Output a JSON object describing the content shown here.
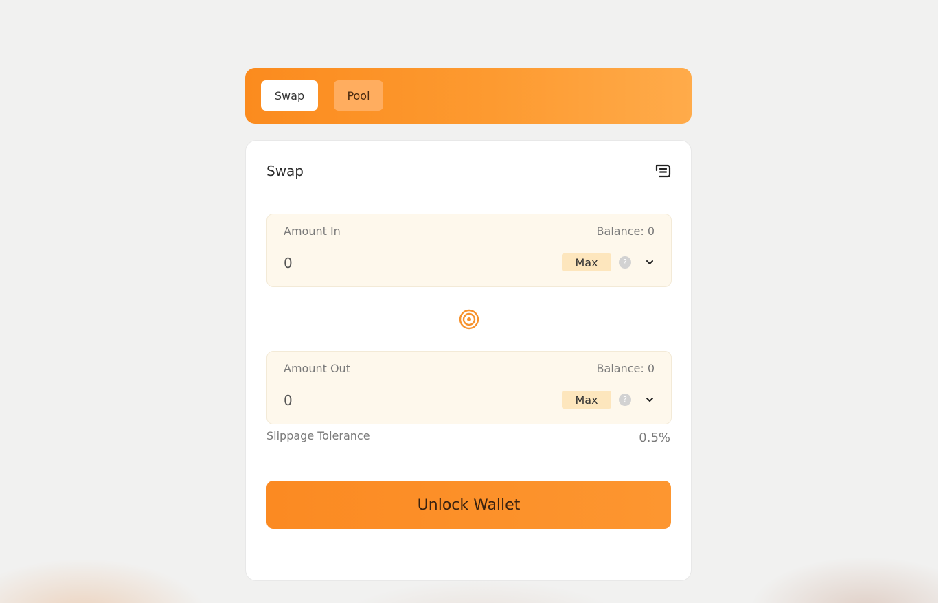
{
  "tabs": [
    {
      "label": "Swap",
      "active": true
    },
    {
      "label": "Pool",
      "active": false
    }
  ],
  "swap_card": {
    "title": "Swap",
    "history_icon": "history-list-icon",
    "amount_in": {
      "label": "Amount In",
      "balance": "Balance: 0",
      "value": "0",
      "max_label": "Max",
      "token_icon": "question-mark-token-icon"
    },
    "amount_out": {
      "label": "Amount Out",
      "balance": "Balance: 0",
      "value": "0",
      "max_label": "Max",
      "token_icon": "question-mark-token-icon"
    },
    "switch_icon": "swap-direction-icon",
    "slippage_label": "Slippage Tolerance",
    "slippage_value": "0.5%",
    "unlock_label": "Unlock Wallet"
  },
  "colors": {
    "accent": "#fd9630",
    "max_button": "#fde6bd",
    "input_box": "#fef8ec"
  }
}
